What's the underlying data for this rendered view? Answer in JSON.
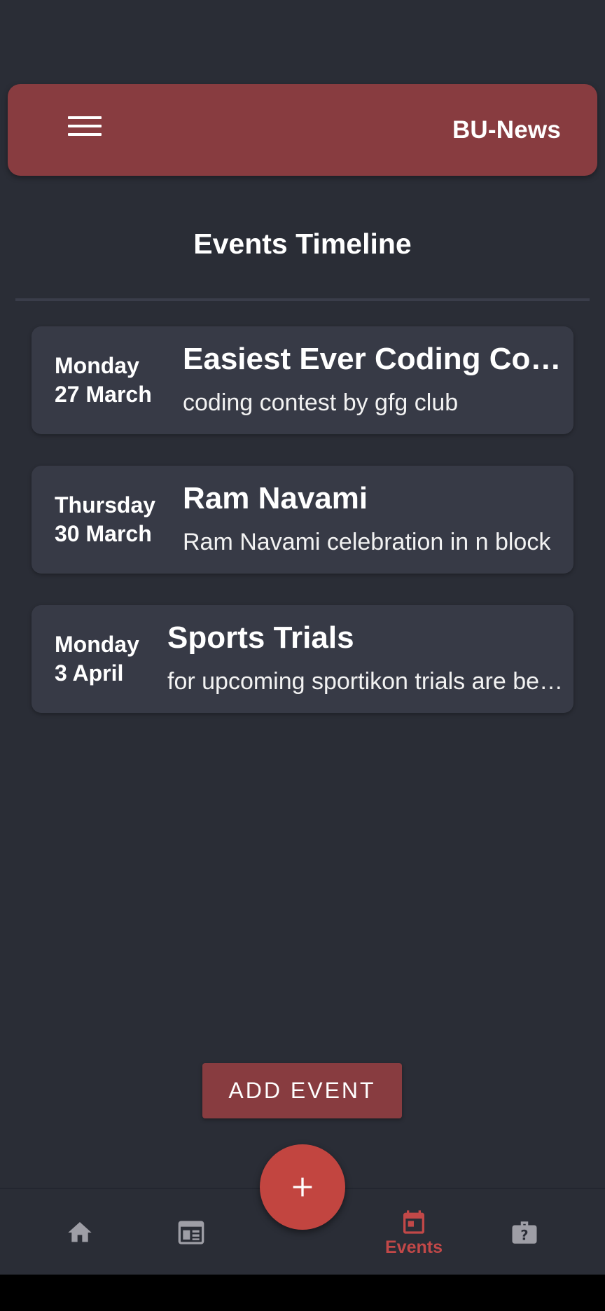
{
  "app_bar": {
    "title": "BU-News",
    "menu_icon": "hamburger-menu-icon"
  },
  "page": {
    "heading": "Events Timeline"
  },
  "events": [
    {
      "day": "Monday",
      "date": "27 March",
      "title": "Easiest Ever Coding Contest",
      "description": "coding contest by gfg club"
    },
    {
      "day": "Thursday",
      "date": "30 March",
      "title": "Ram Navami",
      "description": "Ram Navami celebration in n block"
    },
    {
      "day": "Monday",
      "date": "3 April",
      "title": "Sports Trials",
      "description": "for upcoming sportikon trials are being held"
    }
  ],
  "actions": {
    "add_event_label": "ADD EVENT",
    "fab_icon": "plus-icon"
  },
  "bottom_nav": {
    "items": [
      {
        "id": "home",
        "icon": "home-icon",
        "label": "",
        "active": false
      },
      {
        "id": "news",
        "icon": "newspaper-icon",
        "label": "",
        "active": false
      },
      {
        "id": "events",
        "icon": "calendar-icon",
        "label": "Events",
        "active": true
      },
      {
        "id": "lost-found",
        "icon": "suitcase-question-icon",
        "label": "",
        "active": false
      }
    ]
  },
  "colors": {
    "background": "#2a2d36",
    "app_bar": "#883c40",
    "card": "#373a46",
    "accent": "#c24540",
    "inactive_icon": "#9e9ea6"
  }
}
